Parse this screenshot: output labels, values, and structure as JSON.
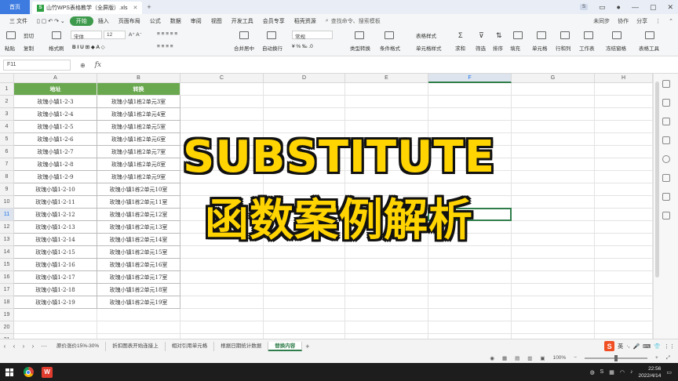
{
  "titlebar": {
    "home_tab": "首页",
    "doc_title": "山竹WPS表格教学（全屏版）.xls",
    "doc_icon": "S",
    "lang_badge": "S"
  },
  "menubar": {
    "items": [
      "三 文件",
      "",
      "开始",
      "插入",
      "页面布局",
      "公式",
      "数据",
      "审阅",
      "视图",
      "开发工具",
      "会员专享",
      "稻壳资源"
    ],
    "search": "查找命令、搜索模板",
    "right": [
      "未同步",
      "协作",
      "分享"
    ]
  },
  "ribbon": {
    "cut": "剪切",
    "paste": "粘贴",
    "copy": "复制",
    "format_painter": "格式刷",
    "font_name": "宋体",
    "font_size": "12",
    "merge": "合并居中",
    "wrap": "自动换行",
    "number_format": "常规",
    "type_convert": "类型转换",
    "cond_format": "条件格式",
    "table_style": "表格样式",
    "cell_style": "单元格样式",
    "sum": "求和",
    "filter": "筛选",
    "sort": "排序",
    "fill": "填充",
    "cell": "单元格",
    "row_col": "行和列",
    "worksheet": "工作表",
    "freeze": "冻结窗格",
    "table_tools": "表格工具"
  },
  "formula_bar": {
    "name_box": "F11",
    "fx": "fx",
    "content": ""
  },
  "grid": {
    "columns": [
      "A",
      "B",
      "C",
      "D",
      "E",
      "F",
      "G",
      "H"
    ],
    "selected_column": "F",
    "selected_row": "11",
    "header_row": [
      "地址",
      "转换"
    ],
    "rows": [
      {
        "n": "2",
        "a": "玫瑰小镇1-2-3",
        "b": "玫瑰小镇1栋2单元3室"
      },
      {
        "n": "3",
        "a": "玫瑰小镇1-2-4",
        "b": "玫瑰小镇1栋2单元4室"
      },
      {
        "n": "4",
        "a": "玫瑰小镇1-2-5",
        "b": "玫瑰小镇1栋2单元5室"
      },
      {
        "n": "5",
        "a": "玫瑰小镇1-2-6",
        "b": "玫瑰小镇1栋2单元6室"
      },
      {
        "n": "6",
        "a": "玫瑰小镇1-2-7",
        "b": "玫瑰小镇1栋2单元7室"
      },
      {
        "n": "7",
        "a": "玫瑰小镇1-2-8",
        "b": "玫瑰小镇1栋2单元8室"
      },
      {
        "n": "8",
        "a": "玫瑰小镇1-2-9",
        "b": "玫瑰小镇1栋2单元9室"
      },
      {
        "n": "9",
        "a": "玫瑰小镇1-2-10",
        "b": "玫瑰小镇1栋2单元10室"
      },
      {
        "n": "10",
        "a": "玫瑰小镇1-2-11",
        "b": "玫瑰小镇1栋2单元11室"
      },
      {
        "n": "11",
        "a": "玫瑰小镇1-2-12",
        "b": "玫瑰小镇1栋2单元12室"
      },
      {
        "n": "12",
        "a": "玫瑰小镇1-2-13",
        "b": "玫瑰小镇1栋2单元13室"
      },
      {
        "n": "13",
        "a": "玫瑰小镇1-2-14",
        "b": "玫瑰小镇1栋2单元14室"
      },
      {
        "n": "14",
        "a": "玫瑰小镇1-2-15",
        "b": "玫瑰小镇1栋2单元15室"
      },
      {
        "n": "15",
        "a": "玫瑰小镇1-2-16",
        "b": "玫瑰小镇1栋2单元16室"
      },
      {
        "n": "16",
        "a": "玫瑰小镇1-2-17",
        "b": "玫瑰小镇1栋2单元17室"
      },
      {
        "n": "17",
        "a": "玫瑰小镇1-2-18",
        "b": "玫瑰小镇1栋2单元18室"
      },
      {
        "n": "18",
        "a": "玫瑰小镇1-2-19",
        "b": "玫瑰小镇1栋2单元19室"
      },
      {
        "n": "19",
        "a": "",
        "b": ""
      },
      {
        "n": "20",
        "a": "",
        "b": ""
      },
      {
        "n": "21",
        "a": "",
        "b": ""
      }
    ],
    "header_color": "#6aa84f",
    "accent_color": "#2f7d4a"
  },
  "overlay": {
    "line1": "SUBSTITUTE",
    "line2": "函数案例解析",
    "color": "#ffd400"
  },
  "sheets": {
    "tabs": [
      "原价涨价15%-30%",
      "折扣图表开始连接上",
      "相对引用单元格",
      "根据日期统计数据",
      "替换内容"
    ],
    "active_index": 4
  },
  "ime": {
    "label": "英"
  },
  "statusbar": {
    "zoom": "100%"
  },
  "taskbar": {
    "time": "22:56",
    "date": "2022/4/14",
    "wps_label": "W"
  }
}
